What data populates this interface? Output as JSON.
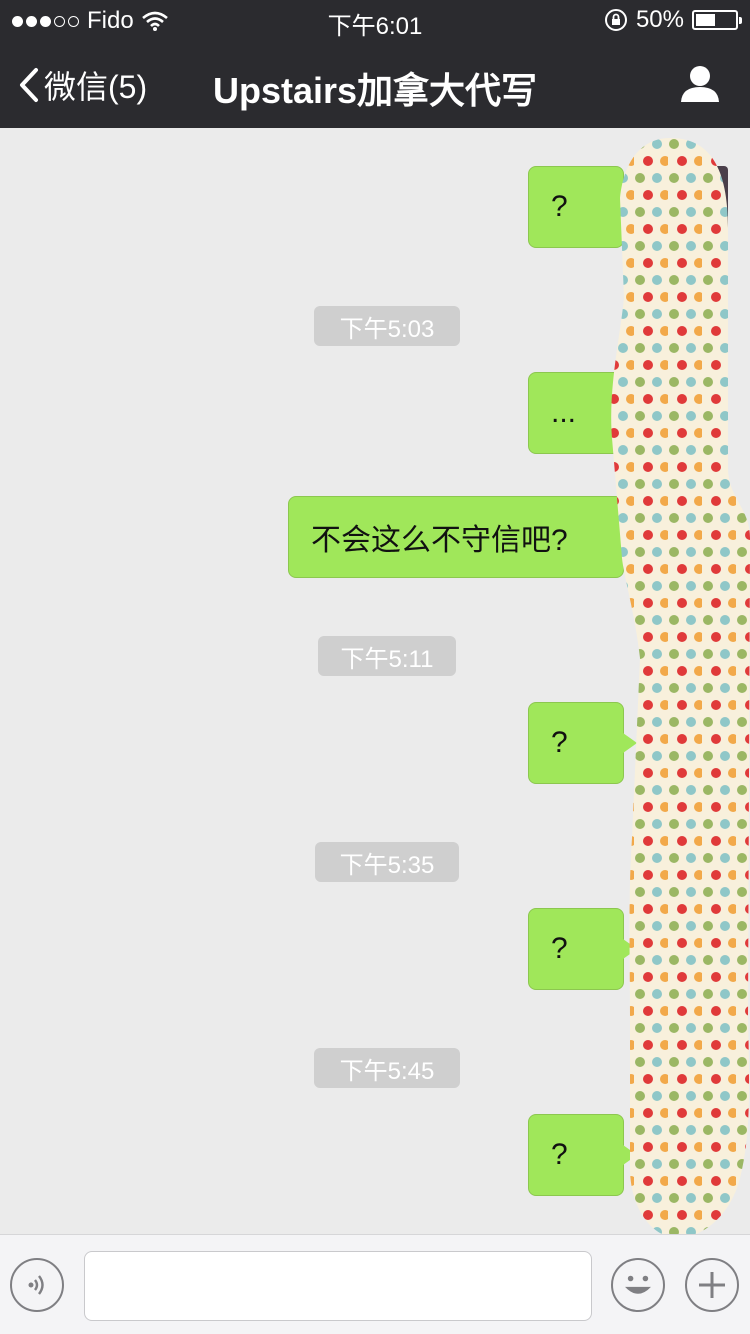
{
  "status_bar": {
    "carrier": "Fido",
    "time": "下午6:01",
    "battery": "50%",
    "battery_level": 0.5
  },
  "nav": {
    "back_label": "微信(5)",
    "title": "Upstairs加拿大代写"
  },
  "messages": [
    {
      "type": "sent",
      "text": "?"
    },
    {
      "type": "time",
      "text": "下午5:03"
    },
    {
      "type": "sent",
      "text": "..."
    },
    {
      "type": "sent",
      "text": "不会这么不守信吧?"
    },
    {
      "type": "time",
      "text": "下午5:11"
    },
    {
      "type": "sent",
      "text": "?"
    },
    {
      "type": "time",
      "text": "下午5:35"
    },
    {
      "type": "sent",
      "text": "?"
    },
    {
      "type": "time",
      "text": "下午5:45"
    },
    {
      "type": "sent",
      "text": "?"
    }
  ],
  "input": {
    "value": "",
    "placeholder": ""
  },
  "icons": {
    "voice": "voice-icon",
    "emoji": "emoji-icon",
    "add": "plus-icon",
    "profile": "profile-icon",
    "back": "chevron-left-icon"
  },
  "colors": {
    "bubble": "#a0e75a",
    "header": "#2b2b2f",
    "background": "#ebebeb"
  }
}
